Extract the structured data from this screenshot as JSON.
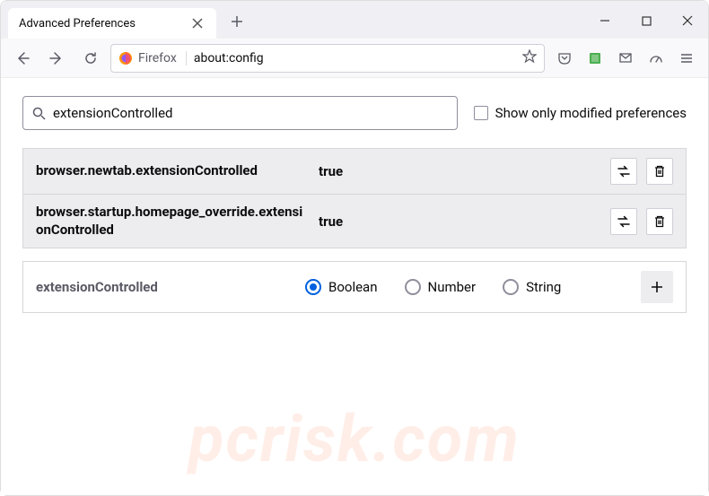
{
  "tab": {
    "title": "Advanced Preferences"
  },
  "urlbar": {
    "identity_label": "Firefox",
    "url": "about:config"
  },
  "search": {
    "value": "extensionControlled",
    "checkbox_label": "Show only modified preferences"
  },
  "prefs": [
    {
      "name": "browser.newtab.extensionControlled",
      "value": "true"
    },
    {
      "name": "browser.startup.homepage_override.extensionControlled",
      "value": "true"
    }
  ],
  "newpref": {
    "name": "extensionControlled",
    "types": [
      "Boolean",
      "Number",
      "String"
    ],
    "selected": "Boolean"
  },
  "watermark": "pcrisk.com"
}
